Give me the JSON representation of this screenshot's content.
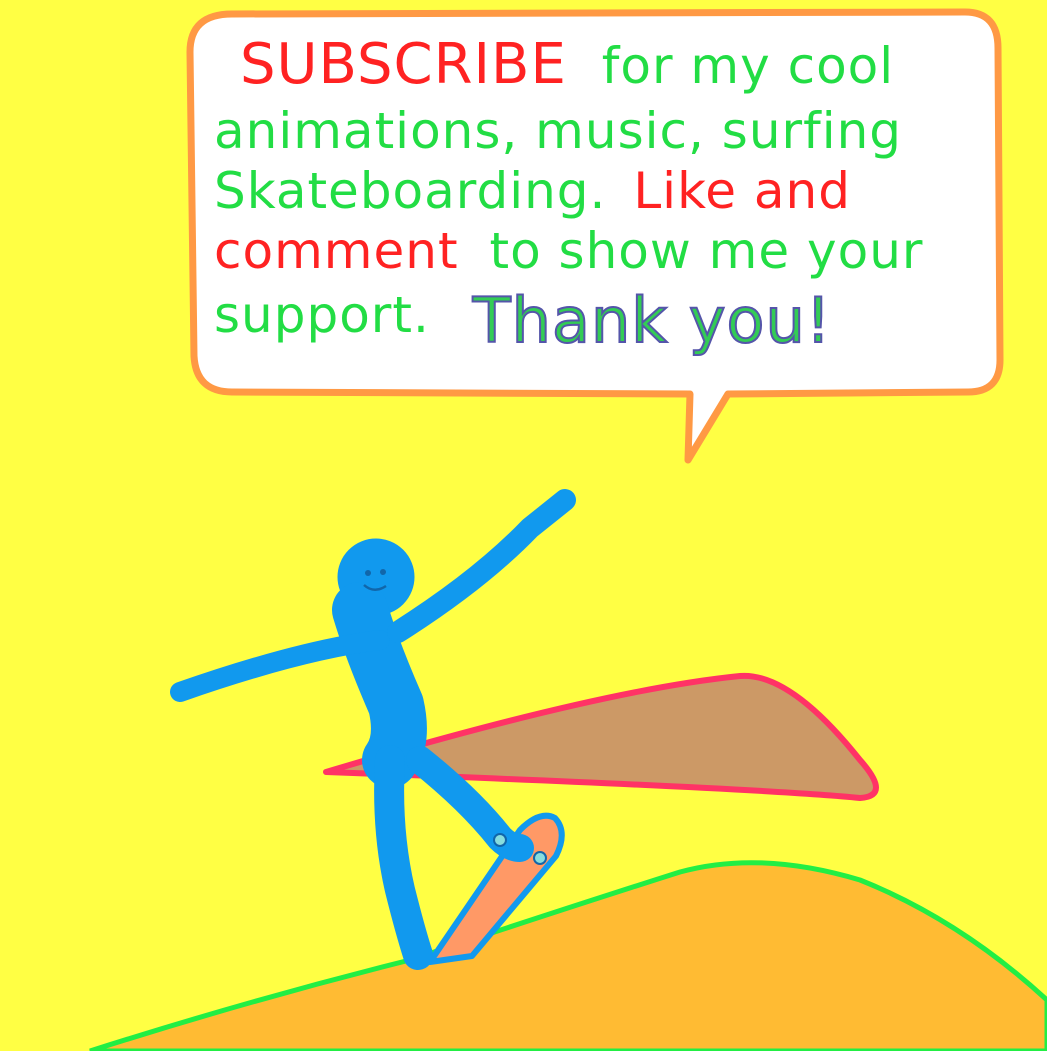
{
  "bubble": {
    "subscribe": "SUBSCRIBE",
    "line1_rest": "for my cool",
    "line2": "animations, music, surfing",
    "line3_green": "Skateboarding.",
    "line3_red": "Like and",
    "line4_red": "comment",
    "line4_green": "to show me your",
    "line5_green": "support.",
    "thank_you": "Thank you!"
  },
  "colors": {
    "background": "#ffff44",
    "bubble_fill": "#ffffff",
    "bubble_outline": "#ff9944",
    "figure": "#1199ee",
    "skateboard": "#ff9966",
    "ramp": "#cc9966",
    "ramp_outline": "#ff3366",
    "hill": "#ffbb33",
    "hill_outline": "#22ee44",
    "red_text": "#ff2222",
    "green_text": "#22dd44"
  }
}
